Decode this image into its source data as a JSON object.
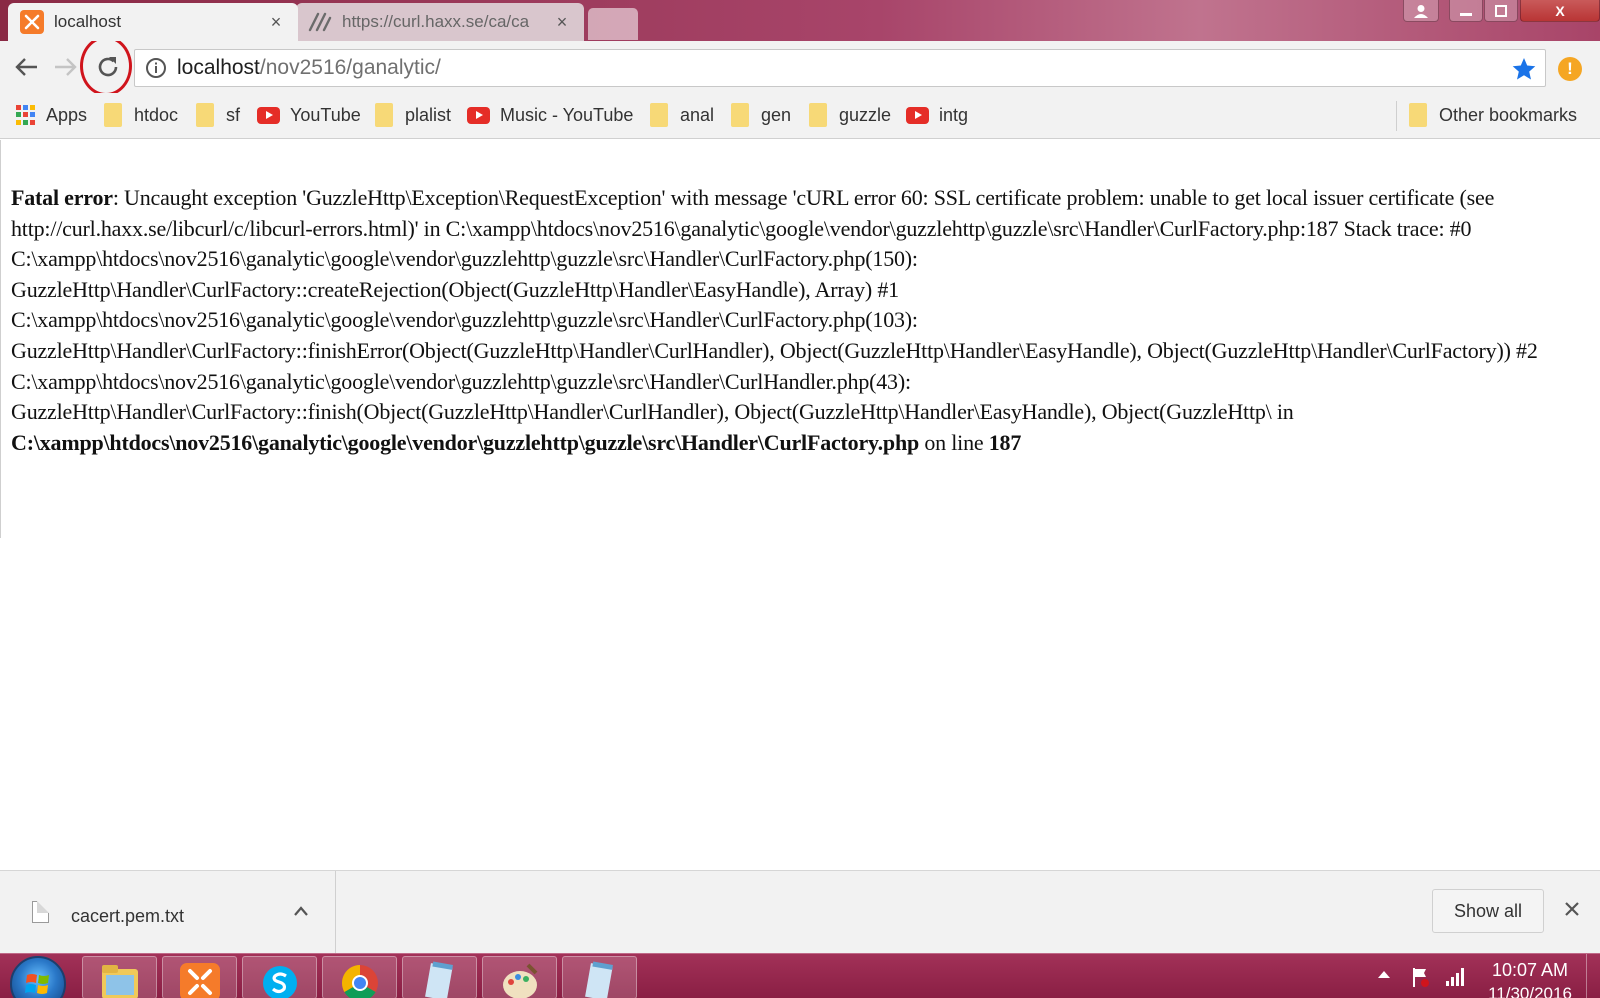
{
  "tabs": [
    {
      "title": "localhost",
      "close": "×"
    },
    {
      "title": "https://curl.haxx.se/ca/ca",
      "close": "×"
    }
  ],
  "window_controls": {
    "close": "X"
  },
  "address_bar": {
    "host": "localhost",
    "path": "/nov2516/ganalytic/"
  },
  "alert_badge": "!",
  "bookmarks": {
    "apps": "Apps",
    "items": [
      {
        "label": "htdoc",
        "icon": "folder-icon"
      },
      {
        "label": "sf",
        "icon": "folder-icon"
      },
      {
        "label": "YouTube",
        "icon": "youtube-icon"
      },
      {
        "label": "plalist",
        "icon": "folder-icon"
      },
      {
        "label": "Music - YouTube",
        "icon": "youtube-icon"
      },
      {
        "label": "anal",
        "icon": "folder-icon"
      },
      {
        "label": "gen",
        "icon": "folder-icon"
      },
      {
        "label": "guzzle",
        "icon": "folder-icon"
      },
      {
        "label": "intg",
        "icon": "youtube-icon"
      }
    ],
    "other": "Other bookmarks"
  },
  "error": {
    "label": "Fatal error",
    "message": ": Uncaught exception 'GuzzleHttp\\Exception\\RequestException' with message 'cURL error 60: SSL certificate problem: unable to get local issuer certificate (see http://curl.haxx.se/libcurl/c/libcurl-errors.html)' in C:\\xampp\\htdocs\\nov2516\\ganalytic\\google\\vendor\\guzzlehttp\\guzzle\\src\\Handler\\CurlFactory.php:187 Stack trace: #0 C:\\xampp\\htdocs\\nov2516\\ganalytic\\google\\vendor\\guzzlehttp\\guzzle\\src\\Handler\\CurlFactory.php(150): GuzzleHttp\\Handler\\CurlFactory::createRejection(Object(GuzzleHttp\\Handler\\EasyHandle), Array) #1 C:\\xampp\\htdocs\\nov2516\\ganalytic\\google\\vendor\\guzzlehttp\\guzzle\\src\\Handler\\CurlFactory.php(103): GuzzleHttp\\Handler\\CurlFactory::finishError(Object(GuzzleHttp\\Handler\\CurlHandler), Object(GuzzleHttp\\Handler\\EasyHandle), Object(GuzzleHttp\\Handler\\CurlFactory)) #2 C:\\xampp\\htdocs\\nov2516\\ganalytic\\google\\vendor\\guzzlehttp\\guzzle\\src\\Handler\\CurlHandler.php(43): GuzzleHttp\\Handler\\CurlFactory::finish(Object(GuzzleHttp\\Handler\\CurlHandler), Object(GuzzleHttp\\Handler\\EasyHandle), Object(GuzzleHttp\\ in ",
    "file": "C:\\xampp\\htdocs\\nov2516\\ganalytic\\google\\vendor\\guzzlehttp\\guzzle\\src\\Handler\\CurlFactory.php",
    "on_line": " on line ",
    "line": "187"
  },
  "download_shelf": {
    "filename": "cacert.pem.txt",
    "show_all": "Show all"
  },
  "taskbar": {
    "time": "10:07 AM",
    "date": "11/30/2016",
    "apps": [
      "explorer-icon",
      "xampp-icon",
      "skype-icon",
      "chrome-icon",
      "notepad-icon",
      "paint-icon",
      "notepad-icon"
    ]
  },
  "colors": {
    "titlebar": "#a8456a",
    "taskbar": "#8a1f44",
    "highlight_ring": "#d0141c",
    "bookmark_star": "#1a73e8",
    "youtube_red": "#e52d27",
    "folder_yellow": "#f7d977"
  }
}
